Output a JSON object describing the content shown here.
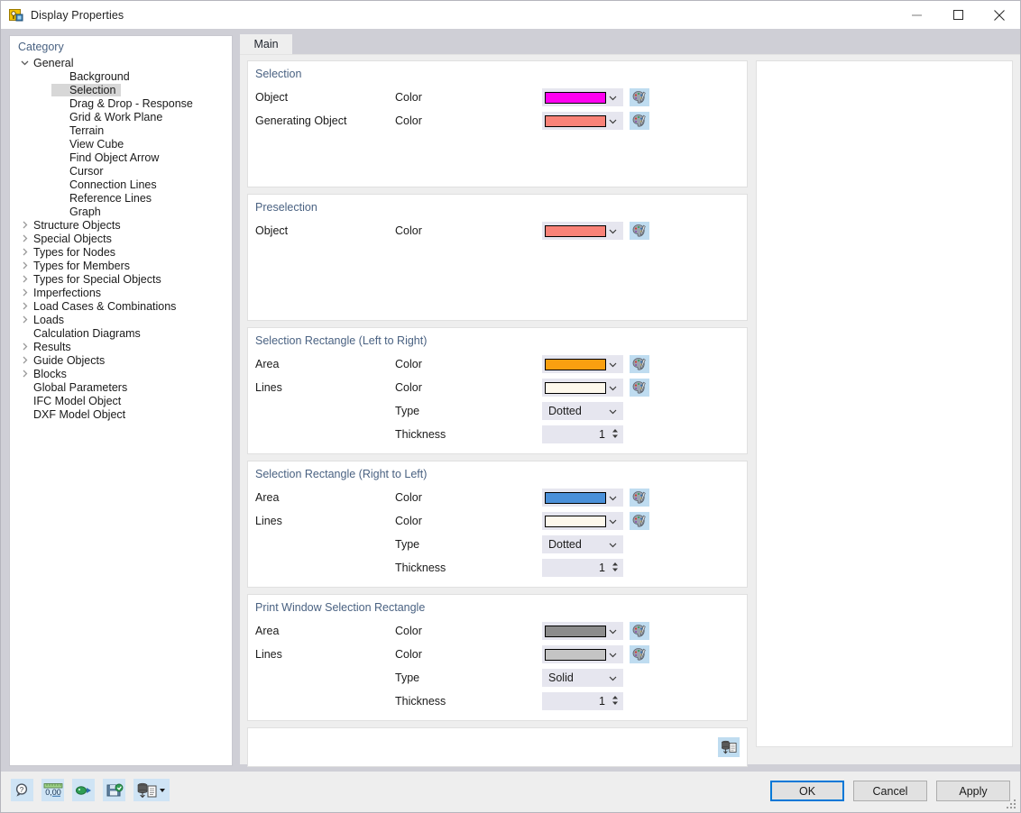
{
  "window": {
    "title": "Display Properties",
    "icon": "app-icon",
    "controls": {
      "minimize": "−",
      "maximize": "□",
      "close": "✕"
    }
  },
  "sidebar": {
    "header": "Category",
    "items": [
      {
        "label": "General",
        "level": 1,
        "caret": "expanded",
        "selected": false
      },
      {
        "label": "Background",
        "level": 2,
        "caret": "none",
        "selected": false
      },
      {
        "label": "Selection",
        "level": 2,
        "caret": "none",
        "selected": true
      },
      {
        "label": "Drag & Drop - Response",
        "level": 2,
        "caret": "none",
        "selected": false
      },
      {
        "label": "Grid & Work Plane",
        "level": 2,
        "caret": "none",
        "selected": false
      },
      {
        "label": "Terrain",
        "level": 2,
        "caret": "none",
        "selected": false
      },
      {
        "label": "View Cube",
        "level": 2,
        "caret": "none",
        "selected": false
      },
      {
        "label": "Find Object Arrow",
        "level": 2,
        "caret": "none",
        "selected": false
      },
      {
        "label": "Cursor",
        "level": 2,
        "caret": "none",
        "selected": false
      },
      {
        "label": "Connection Lines",
        "level": 2,
        "caret": "none",
        "selected": false
      },
      {
        "label": "Reference Lines",
        "level": 2,
        "caret": "none",
        "selected": false
      },
      {
        "label": "Graph",
        "level": 2,
        "caret": "none",
        "selected": false
      },
      {
        "label": "Structure Objects",
        "level": 1,
        "caret": "collapsed",
        "selected": false
      },
      {
        "label": "Special Objects",
        "level": 1,
        "caret": "collapsed",
        "selected": false
      },
      {
        "label": "Types for Nodes",
        "level": 1,
        "caret": "collapsed",
        "selected": false
      },
      {
        "label": "Types for Members",
        "level": 1,
        "caret": "collapsed",
        "selected": false
      },
      {
        "label": "Types for Special Objects",
        "level": 1,
        "caret": "collapsed",
        "selected": false
      },
      {
        "label": "Imperfections",
        "level": 1,
        "caret": "collapsed",
        "selected": false
      },
      {
        "label": "Load Cases & Combinations",
        "level": 1,
        "caret": "collapsed",
        "selected": false
      },
      {
        "label": "Loads",
        "level": 1,
        "caret": "collapsed",
        "selected": false
      },
      {
        "label": "Calculation Diagrams",
        "level": 1,
        "caret": "none",
        "selected": false
      },
      {
        "label": "Results",
        "level": 1,
        "caret": "collapsed",
        "selected": false
      },
      {
        "label": "Guide Objects",
        "level": 1,
        "caret": "collapsed",
        "selected": false
      },
      {
        "label": "Blocks",
        "level": 1,
        "caret": "collapsed",
        "selected": false
      },
      {
        "label": "Global Parameters",
        "level": 1,
        "caret": "none",
        "selected": false
      },
      {
        "label": "IFC Model Object",
        "level": 1,
        "caret": "none",
        "selected": false
      },
      {
        "label": "DXF Model Object",
        "level": 1,
        "caret": "none",
        "selected": false
      }
    ]
  },
  "tabs": [
    {
      "label": "Main",
      "active": true
    }
  ],
  "groups": [
    {
      "title": "Selection",
      "rows": [
        {
          "label": "Object",
          "prop": "Color",
          "kind": "color",
          "color": "#ff00f0",
          "palette": true
        },
        {
          "label": "Generating Object",
          "prop": "Color",
          "kind": "color",
          "color": "#f98278",
          "palette": true
        }
      ],
      "pad_rows": 2
    },
    {
      "title": "Preselection",
      "rows": [
        {
          "label": "Object",
          "prop": "Color",
          "kind": "color",
          "color": "#f98278",
          "palette": true
        }
      ],
      "pad_rows": 3
    },
    {
      "title": "Selection Rectangle (Left to Right)",
      "rows": [
        {
          "label": "Area",
          "prop": "Color",
          "kind": "color",
          "color": "#f99f10",
          "palette": true
        },
        {
          "label": "Lines",
          "prop": "Color",
          "kind": "color",
          "color": "#fdf8ec",
          "palette": true
        },
        {
          "label": "",
          "prop": "Type",
          "kind": "select",
          "value": "Dotted"
        },
        {
          "label": "",
          "prop": "Thickness",
          "kind": "spin",
          "value": "1"
        }
      ],
      "pad_rows": 0
    },
    {
      "title": "Selection Rectangle (Right to Left)",
      "rows": [
        {
          "label": "Area",
          "prop": "Color",
          "kind": "color",
          "color": "#4a90d9",
          "palette": true
        },
        {
          "label": "Lines",
          "prop": "Color",
          "kind": "color",
          "color": "#fdf8ec",
          "palette": true
        },
        {
          "label": "",
          "prop": "Type",
          "kind": "select",
          "value": "Dotted"
        },
        {
          "label": "",
          "prop": "Thickness",
          "kind": "spin",
          "value": "1"
        }
      ],
      "pad_rows": 0
    },
    {
      "title": "Print Window Selection Rectangle",
      "rows": [
        {
          "label": "Area",
          "prop": "Color",
          "kind": "color",
          "color": "#8c8c8c",
          "palette": true
        },
        {
          "label": "Lines",
          "prop": "Color",
          "kind": "color",
          "color": "#c4c4c4",
          "palette": true
        },
        {
          "label": "",
          "prop": "Type",
          "kind": "select",
          "value": "Solid"
        },
        {
          "label": "",
          "prop": "Thickness",
          "kind": "spin",
          "value": "1"
        }
      ],
      "pad_rows": 0
    }
  ],
  "footer_strip": {
    "icon": "save-to-database-icon"
  },
  "bottom_toolbar": [
    {
      "name": "help-search-icon"
    },
    {
      "name": "decimal-places-icon",
      "text": "0,00"
    },
    {
      "name": "import-colors-icon"
    },
    {
      "name": "export-colors-icon"
    },
    {
      "name": "database-settings-icon",
      "has_dropdown": true
    }
  ],
  "dialog_buttons": [
    {
      "label": "OK",
      "primary": true
    },
    {
      "label": "Cancel",
      "primary": false
    },
    {
      "label": "Apply",
      "primary": false
    }
  ],
  "colors": {
    "accent": "#0078d7",
    "group_title": "#4a6282",
    "field_bg": "#e6e6ef",
    "palette_btn": "#bfdcf0",
    "selection_row": "#d7d7d7"
  }
}
